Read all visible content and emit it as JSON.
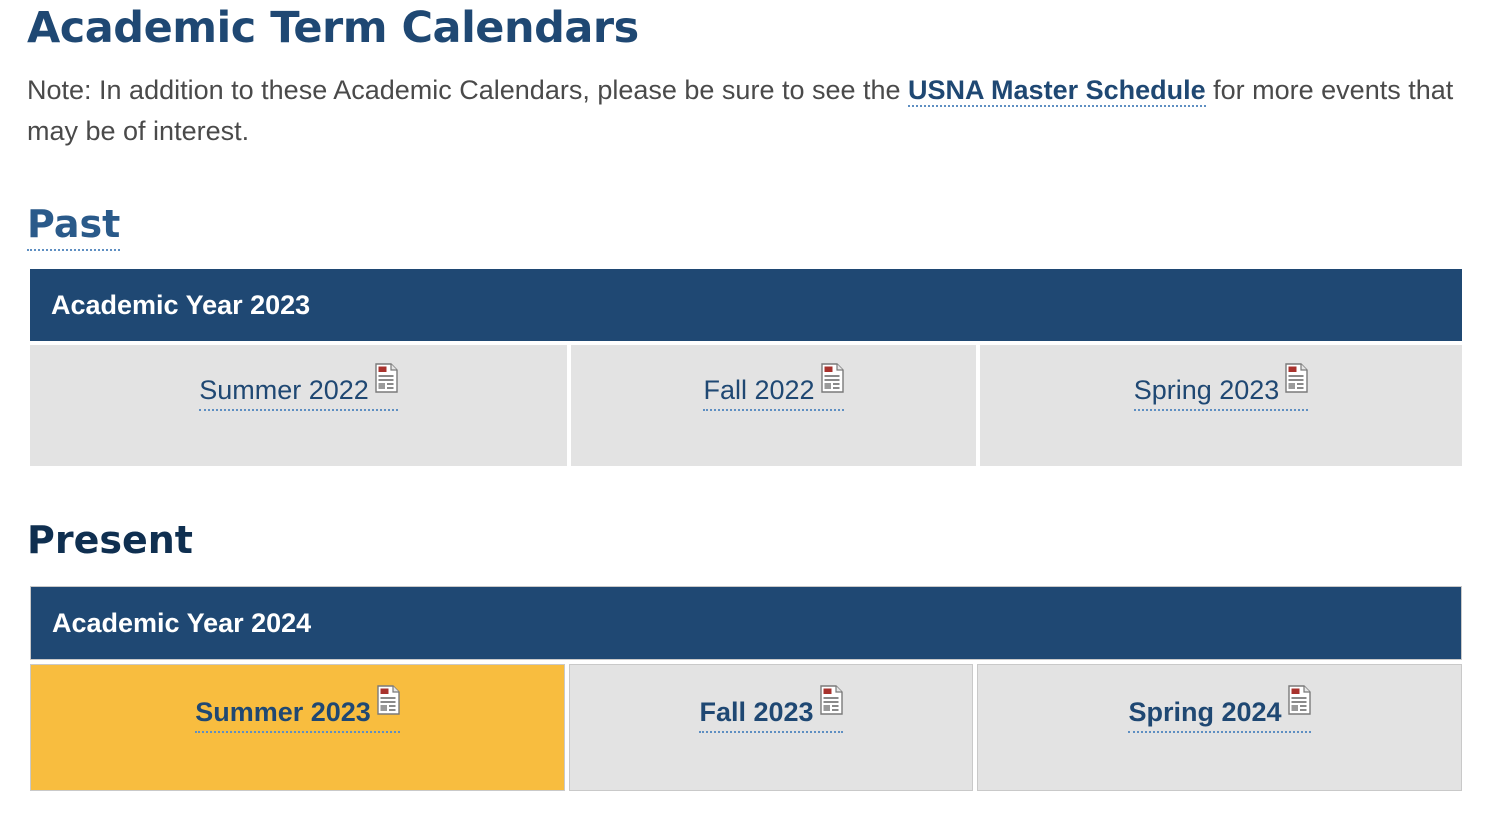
{
  "page": {
    "title": "Academic Term Calendars"
  },
  "note": {
    "prefix": "Note: In addition to these Academic Calendars, please be sure to see the ",
    "link_label": "USNA Master Schedule",
    "suffix": " for more events that may be of interest."
  },
  "sections": {
    "past": {
      "heading": "Past",
      "year_label": "Academic Year 2023",
      "terms": [
        {
          "label": "Summer 2022",
          "icon": "document-icon"
        },
        {
          "label": "Fall 2022",
          "icon": "document-icon"
        },
        {
          "label": "Spring 2023",
          "icon": "document-icon"
        }
      ]
    },
    "present": {
      "heading": "Present",
      "year_label": "Academic Year 2024",
      "terms": [
        {
          "label": "Summer 2023",
          "icon": "document-icon",
          "current": true
        },
        {
          "label": "Fall 2023",
          "icon": "document-icon"
        },
        {
          "label": "Spring 2024",
          "icon": "document-icon"
        }
      ]
    }
  },
  "colors": {
    "heading_blue": "#1f4873",
    "header_bg": "#1f4873",
    "cell_bg": "#e3e3e3",
    "current_term_bg": "#f8bd3f",
    "body_text": "#4a4a4a"
  }
}
